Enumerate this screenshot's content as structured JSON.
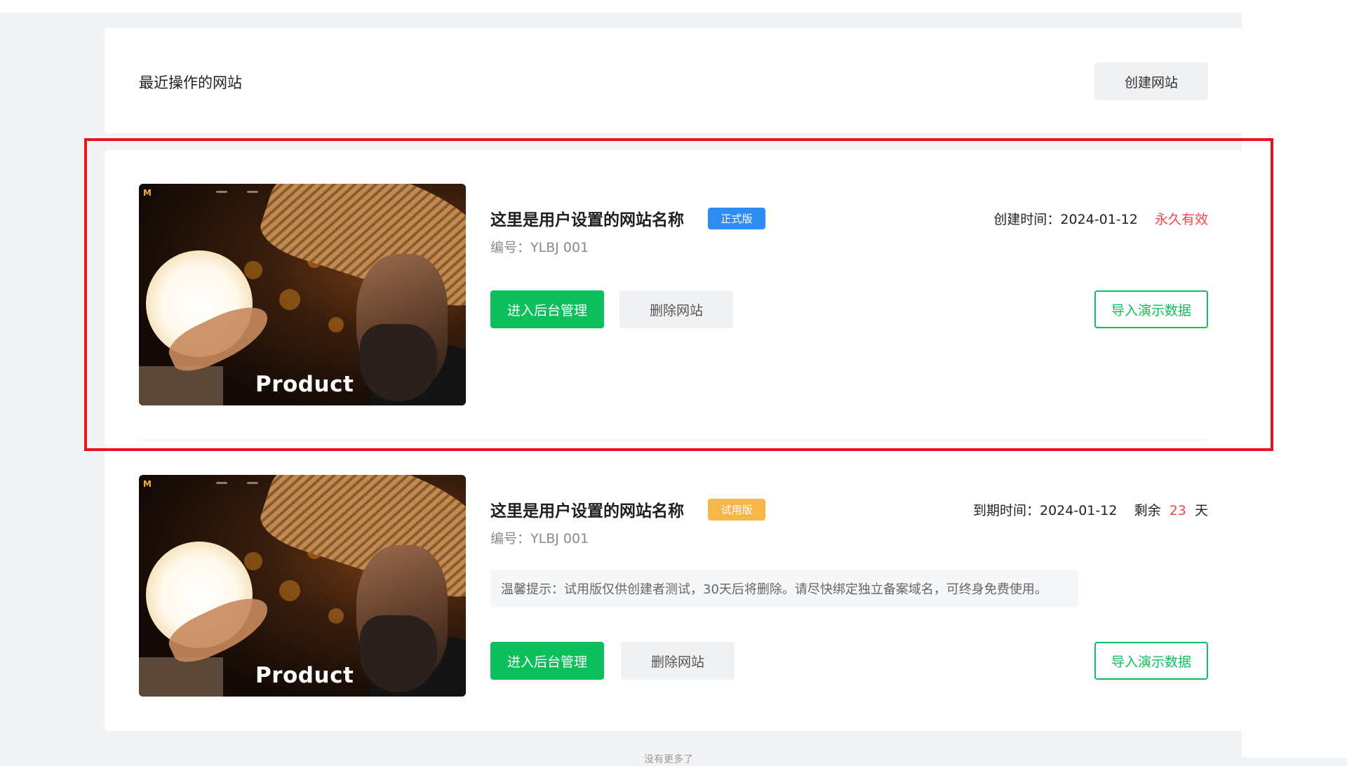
{
  "header": {
    "title": "最近操作的网站",
    "create_label": "创建网站"
  },
  "sites": [
    {
      "name": "这里是用户设置的网站名称",
      "badge": "正式版",
      "code": "编号：YLBJ 001",
      "meta_label": "创建时间：",
      "meta_date": "2024-01-12",
      "status": "永久有效",
      "thumb_label": "Product",
      "enter_label": "进入后台管理",
      "delete_label": "删除网站",
      "import_label": "导入演示数据"
    },
    {
      "name": "这里是用户设置的网站名称",
      "badge": "试用版",
      "code": "编号：YLBJ 001",
      "meta_label": "到期时间：",
      "meta_date": "2024-01-12",
      "remain_label": "剩余",
      "remain_days": "23",
      "remain_unit": "天",
      "notice": "温馨提示：试用版仅供创建者测试，30天后将删除。请尽快绑定独立备案域名，可终身免费使用。",
      "thumb_label": "Product",
      "enter_label": "进入后台管理",
      "delete_label": "删除网站",
      "import_label": "导入演示数据"
    }
  ],
  "footer": {
    "text": "没有更多了"
  },
  "colors": {
    "primary": "#0cbf5b",
    "formal_badge": "#2f8cf0",
    "trial_badge": "#f7b64a",
    "alert": "#f04848",
    "highlight": "#e8141b"
  }
}
